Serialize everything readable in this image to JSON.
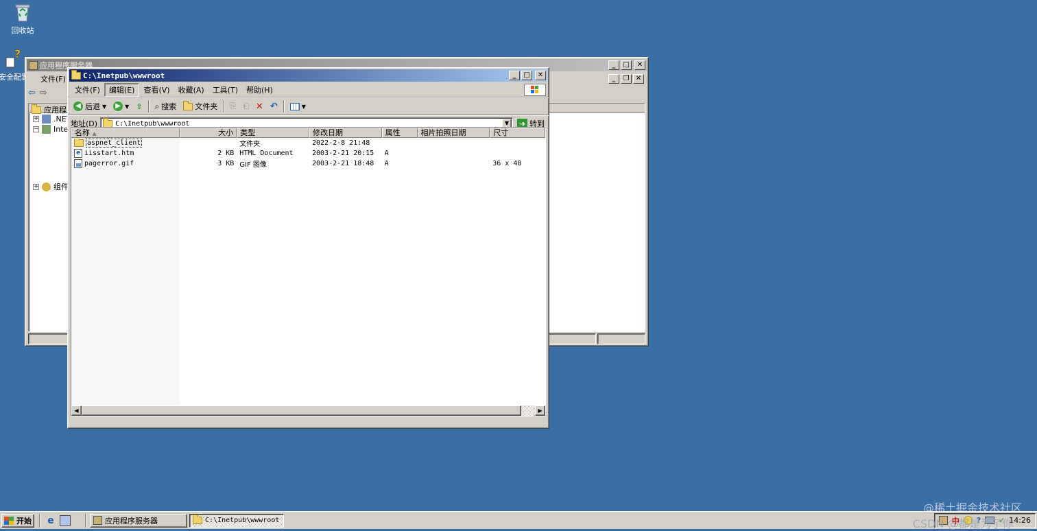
{
  "desktop": {
    "icons": [
      {
        "label": "回收站"
      },
      {
        "label": "安全配置"
      }
    ],
    "watermark": "@稀土掘金技术社区",
    "watermark2": "CSDN @都是为了你"
  },
  "bg_window": {
    "title": "应用程序服务器",
    "menu_file": "文件(F)",
    "tree": [
      {
        "label": "应用程序"
      },
      {
        "label": ".NET"
      },
      {
        "label": "Inte"
      },
      {
        "label": "组件"
      }
    ]
  },
  "explorer": {
    "title": "C:\\Inetpub\\wwwroot",
    "menu": [
      "文件(F)",
      "编辑(E)",
      "查看(V)",
      "收藏(A)",
      "工具(T)",
      "帮助(H)"
    ],
    "toolbar": {
      "back": "后退",
      "search": "搜索",
      "folders": "文件夹"
    },
    "address_label": "地址(D)",
    "address_value": "C:\\Inetpub\\wwwroot",
    "go_label": "转到",
    "columns": [
      "名称",
      "大小",
      "类型",
      "修改日期",
      "属性",
      "相片拍照日期",
      "尺寸"
    ],
    "files": [
      {
        "name": "aspnet_client",
        "size": "",
        "type": "文件夹",
        "modified": "2022-2-8 21:48",
        "attr": "",
        "photo_date": "",
        "dims": ""
      },
      {
        "name": "iisstart.htm",
        "size": "2 KB",
        "type": "HTML Document",
        "modified": "2003-2-21 20:15",
        "attr": "A",
        "photo_date": "",
        "dims": ""
      },
      {
        "name": "pagerror.gif",
        "size": "3 KB",
        "type": "GIF 图像",
        "modified": "2003-2-21 18:48",
        "attr": "A",
        "photo_date": "",
        "dims": "36 x 48"
      }
    ]
  },
  "taskbar": {
    "start": "开始",
    "tasks": [
      {
        "label": "应用程序服务器"
      },
      {
        "label": "C:\\Inetpub\\wwwroot"
      }
    ],
    "tray_lang": "中",
    "clock": "14:26"
  },
  "colors": {
    "desktop": "#3a6ea5",
    "title_active": "#0a246a",
    "title_inactive": "#808080"
  }
}
